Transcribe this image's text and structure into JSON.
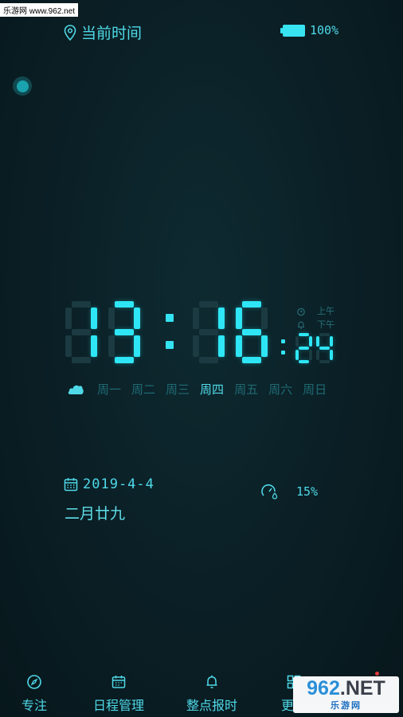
{
  "watermark": "乐游网 www.962.net",
  "header": {
    "location_label": "当前时间",
    "battery_text": "100%"
  },
  "clock": {
    "hours": "13",
    "minutes": "16",
    "seconds": "24",
    "am_label": "上午",
    "pm_label": "下午"
  },
  "weekdays": {
    "items": [
      "周一",
      "周二",
      "周三",
      "周四",
      "周五",
      "周六",
      "周日"
    ],
    "active": "周四"
  },
  "date": {
    "gregorian": "2019-4-4",
    "lunar": "二月廿九"
  },
  "humidity": {
    "value": "15%"
  },
  "nav": {
    "items": [
      {
        "label": "专注"
      },
      {
        "label": "日程管理"
      },
      {
        "label": "整点报时"
      },
      {
        "label": "更多"
      }
    ]
  },
  "logo": {
    "main_number": "962",
    "main_suffix": ".NET",
    "sub": "乐游网"
  },
  "colors": {
    "accent": "#2ee6f5",
    "dim": "#1b3a41",
    "background": "#0a1f25"
  }
}
